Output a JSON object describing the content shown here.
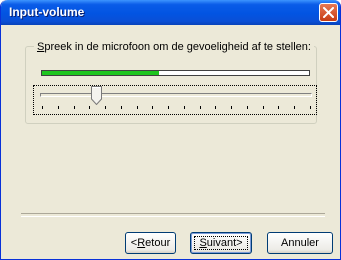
{
  "window": {
    "title": "Input-volume",
    "close_icon": "close-icon",
    "title_color": "#0a5ce8",
    "close_color": "#d8501f"
  },
  "group": {
    "label_accel": "S",
    "label_rest": "preek in de microfoon om de gevoeligheid af te stellen:"
  },
  "meter": {
    "level": 0.44,
    "color": "#1ec51e"
  },
  "slider": {
    "value": 0.2,
    "tick_count": 18
  },
  "buttons": {
    "back_accel": "R",
    "back_prefix": "<",
    "back_rest": "etour",
    "next_accel": "S",
    "next_rest": "uivant>",
    "cancel_label": "Annuler"
  }
}
